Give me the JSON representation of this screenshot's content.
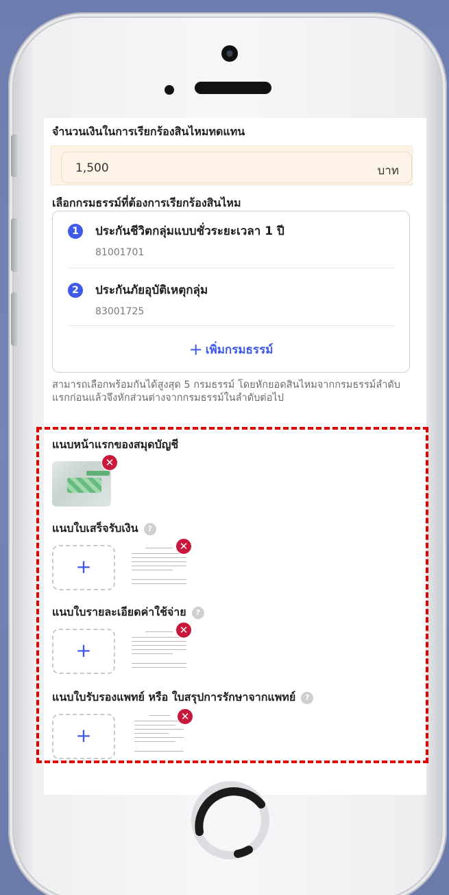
{
  "claim": {
    "amount_label": "จำนวนเงินในการเรียกร้องสินไหมทดแทน",
    "amount_value": "1,500",
    "amount_unit": "บาท"
  },
  "policies": {
    "label": "เลือกกรมธรรม์ที่ต้องการเรียกร้องสินไหม",
    "items": [
      {
        "index": "1",
        "name": "ประกันชีวิตกลุ่มแบบชั่วระยะเวลา 1 ปี",
        "number": "81001701"
      },
      {
        "index": "2",
        "name": "ประกันภัยอุบัติเหตุกลุ่ม",
        "number": "83001725"
      }
    ],
    "add_label": "เพิ่มกรมธรรม์",
    "add_symbol": "+",
    "note": "สามารถเลือกพร้อมกันได้สูงสุด 5 กรมธรรม์ โดยหักยอดสินไหมจากกรมธรรม์ลำดับแรกก่อนแล้วจึงหักส่วนต่างจากกรมธรรม์ในลำดับต่อไป"
  },
  "attachments": {
    "passbook_label": "แนบหน้าแรกของสมุดบัญชี",
    "receipt_label": "แนบใบเสร็จรับเงิน",
    "expense_label": "แนบใบรายละเอียดค่าใช้จ่าย",
    "medical_label": "แนบใบรับรองแพทย์ หรือ ใบสรุปการรักษาจากแพทย์",
    "help_symbol": "?",
    "remove_symbol": "✕",
    "add_symbol": "+"
  },
  "colors": {
    "accent": "#3f59e8",
    "highlight_border": "#e50000",
    "remove_badge": "#c8183c",
    "amount_bg": "#fdf3e6"
  }
}
